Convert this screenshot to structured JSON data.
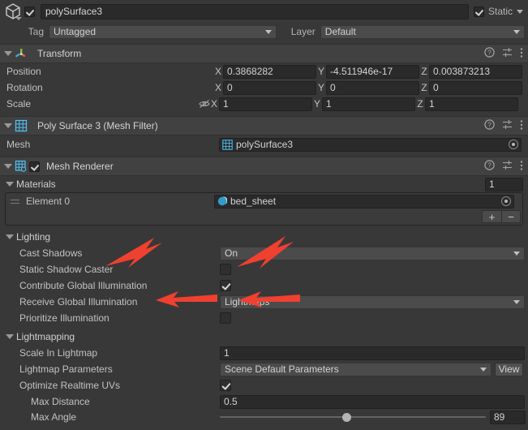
{
  "object_header": {
    "icon": "gameobject-cube-icon",
    "enabled": true,
    "name": "polySurface3",
    "static_checked": true,
    "static_label": "Static"
  },
  "tag_layer": {
    "tag_label": "Tag",
    "tag_value": "Untagged",
    "layer_label": "Layer",
    "layer_value": "Default"
  },
  "components": [
    {
      "id": "transform",
      "title": "Transform",
      "icon": "transform-axis-icon",
      "has_enable_checkbox": false,
      "rows": [
        {
          "label": "Position",
          "x": "0.3868282",
          "y": "-4.511946e-17",
          "z": "0.003873213"
        },
        {
          "label": "Rotation",
          "x": "0",
          "y": "0",
          "z": "0"
        },
        {
          "label": "Scale",
          "x": "1",
          "y": "1",
          "z": "1"
        }
      ],
      "axis_labels": {
        "x": "X",
        "y": "Y",
        "z": "Z"
      }
    },
    {
      "id": "mesh-filter",
      "title": "Poly Surface 3 (Mesh Filter)",
      "icon": "mesh-filter-grid-icon",
      "has_enable_checkbox": false,
      "mesh_label": "Mesh",
      "mesh_value": "polySurface3"
    },
    {
      "id": "mesh-renderer",
      "title": "Mesh Renderer",
      "icon": "mesh-renderer-grid-icon",
      "has_enable_checkbox": true,
      "enabled": true
    }
  ],
  "materials": {
    "section_label": "Materials",
    "size_value": "1",
    "element_label": "Element 0",
    "element_value": "bed_sheet",
    "add_label": "+",
    "remove_label": "−"
  },
  "lighting": {
    "section_label": "Lighting",
    "rows": [
      {
        "label": "Cast Shadows",
        "type": "popup",
        "value": "On"
      },
      {
        "label": "Static Shadow Caster",
        "type": "checkbox",
        "value": false
      },
      {
        "label": "Contribute Global Illumination",
        "type": "checkbox",
        "value": true
      },
      {
        "label": "Receive Global Illumination",
        "type": "popup",
        "value": "Lightmaps"
      },
      {
        "label": "Prioritize Illumination",
        "type": "checkbox",
        "value": false
      }
    ]
  },
  "lightmapping": {
    "section_label": "Lightmapping",
    "rows": [
      {
        "label": "Scale In Lightmap",
        "type": "text",
        "value": "1"
      },
      {
        "label": "Lightmap Parameters",
        "type": "popup-button",
        "value": "Scene Default Parameters",
        "button": "View"
      },
      {
        "label": "Optimize Realtime UVs",
        "type": "checkbox",
        "value": true
      },
      {
        "label": "Max Distance",
        "type": "text",
        "value": "0.5",
        "indent": true
      },
      {
        "label": "Max Angle",
        "type": "slider",
        "value": "89",
        "indent": true,
        "slider_pct": 46
      }
    ]
  },
  "annotations": {
    "color": "#f04030",
    "arrows": [
      {
        "name": "arrow-cast-shadows-label"
      },
      {
        "name": "arrow-cast-shadows-value"
      },
      {
        "name": "arrow-contribute-gi-label"
      },
      {
        "name": "arrow-contribute-gi-checkbox"
      }
    ]
  }
}
